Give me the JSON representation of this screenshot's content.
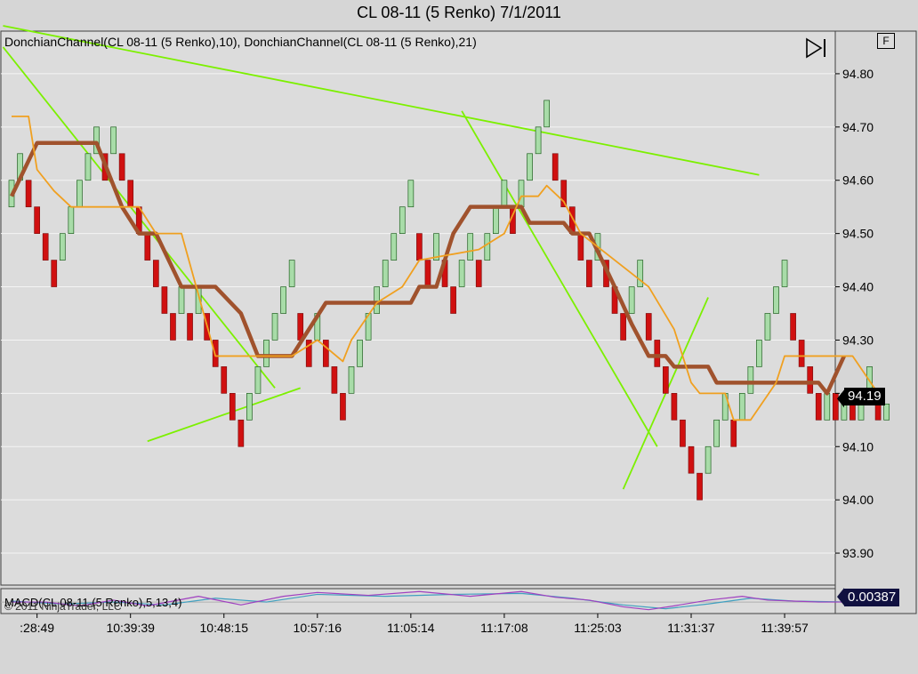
{
  "title": "CL 08-11 (5 Renko)  7/1/2011",
  "indicator_label": "DonchianChannel(CL 08-11 (5 Renko),10), DonchianChannel(CL 08-11 (5 Renko),21)",
  "macd_label": "MACD(CL 08-11 (5 Renko),5,13,4)",
  "copyright": "© 2011 NinjaTrader, LLC",
  "f_button": "F",
  "last_price": "94.19",
  "macd_value": "0.00387",
  "colors": {
    "background": "#dcdcdc",
    "up_brick": "#a8dca8",
    "down_brick": "#d01010",
    "donchian_10": "#f0a020",
    "donchian_21": "#a0522d",
    "trendline": "#7cf000",
    "macd_line": "#a040c0",
    "macd_signal": "#40a0c0"
  },
  "chart_data": {
    "type": "candlestick",
    "subtype": "renko",
    "brick_size": 0.05,
    "ylim": [
      93.84,
      94.88
    ],
    "yticks": [
      "94.80",
      "94.70",
      "94.60",
      "94.50",
      "94.40",
      "94.30",
      "94.00",
      "93.90"
    ],
    "ytick_values": [
      94.8,
      94.7,
      94.6,
      94.5,
      94.4,
      94.3,
      94.0,
      93.9
    ],
    "ytick_hidden_labels": [
      94.2,
      94.1
    ],
    "ytick_secondary": [
      {
        "value": 94.1,
        "label": "94.10"
      }
    ],
    "xticks": [
      ":28:49",
      "10:39:39",
      "10:48:15",
      "10:57:16",
      "11:05:14",
      "11:17:08",
      "11:25:03",
      "11:31:37",
      "11:39:57"
    ],
    "xtick_index": [
      3,
      14,
      25,
      36,
      47,
      58,
      69,
      80,
      91
    ],
    "bricks": [
      {
        "o": 94.55,
        "c": 94.6
      },
      {
        "o": 94.6,
        "c": 94.65
      },
      {
        "o": 94.6,
        "c": 94.55
      },
      {
        "o": 94.55,
        "c": 94.5
      },
      {
        "o": 94.5,
        "c": 94.45
      },
      {
        "o": 94.45,
        "c": 94.4
      },
      {
        "o": 94.45,
        "c": 94.5
      },
      {
        "o": 94.5,
        "c": 94.55
      },
      {
        "o": 94.55,
        "c": 94.6
      },
      {
        "o": 94.6,
        "c": 94.65
      },
      {
        "o": 94.65,
        "c": 94.7
      },
      {
        "o": 94.65,
        "c": 94.6
      },
      {
        "o": 94.65,
        "c": 94.7
      },
      {
        "o": 94.65,
        "c": 94.6
      },
      {
        "o": 94.6,
        "c": 94.55
      },
      {
        "o": 94.55,
        "c": 94.5
      },
      {
        "o": 94.5,
        "c": 94.45
      },
      {
        "o": 94.45,
        "c": 94.4
      },
      {
        "o": 94.4,
        "c": 94.35
      },
      {
        "o": 94.35,
        "c": 94.3
      },
      {
        "o": 94.35,
        "c": 94.4
      },
      {
        "o": 94.35,
        "c": 94.3
      },
      {
        "o": 94.35,
        "c": 94.4
      },
      {
        "o": 94.35,
        "c": 94.3
      },
      {
        "o": 94.3,
        "c": 94.25
      },
      {
        "o": 94.25,
        "c": 94.2
      },
      {
        "o": 94.2,
        "c": 94.15
      },
      {
        "o": 94.15,
        "c": 94.1
      },
      {
        "o": 94.15,
        "c": 94.2
      },
      {
        "o": 94.2,
        "c": 94.25
      },
      {
        "o": 94.25,
        "c": 94.3
      },
      {
        "o": 94.3,
        "c": 94.35
      },
      {
        "o": 94.35,
        "c": 94.4
      },
      {
        "o": 94.4,
        "c": 94.45
      },
      {
        "o": 94.35,
        "c": 94.3
      },
      {
        "o": 94.3,
        "c": 94.25
      },
      {
        "o": 94.3,
        "c": 94.35
      },
      {
        "o": 94.3,
        "c": 94.25
      },
      {
        "o": 94.25,
        "c": 94.2
      },
      {
        "o": 94.2,
        "c": 94.15
      },
      {
        "o": 94.2,
        "c": 94.25
      },
      {
        "o": 94.25,
        "c": 94.3
      },
      {
        "o": 94.3,
        "c": 94.35
      },
      {
        "o": 94.35,
        "c": 94.4
      },
      {
        "o": 94.4,
        "c": 94.45
      },
      {
        "o": 94.45,
        "c": 94.5
      },
      {
        "o": 94.5,
        "c": 94.55
      },
      {
        "o": 94.55,
        "c": 94.6
      },
      {
        "o": 94.5,
        "c": 94.45
      },
      {
        "o": 94.45,
        "c": 94.4
      },
      {
        "o": 94.45,
        "c": 94.5
      },
      {
        "o": 94.45,
        "c": 94.4
      },
      {
        "o": 94.4,
        "c": 94.35
      },
      {
        "o": 94.4,
        "c": 94.45
      },
      {
        "o": 94.45,
        "c": 94.5
      },
      {
        "o": 94.45,
        "c": 94.4
      },
      {
        "o": 94.45,
        "c": 94.5
      },
      {
        "o": 94.5,
        "c": 94.55
      },
      {
        "o": 94.55,
        "c": 94.6
      },
      {
        "o": 94.55,
        "c": 94.5
      },
      {
        "o": 94.55,
        "c": 94.6
      },
      {
        "o": 94.6,
        "c": 94.65
      },
      {
        "o": 94.65,
        "c": 94.7
      },
      {
        "o": 94.7,
        "c": 94.75
      },
      {
        "o": 94.65,
        "c": 94.6
      },
      {
        "o": 94.6,
        "c": 94.55
      },
      {
        "o": 94.55,
        "c": 94.5
      },
      {
        "o": 94.5,
        "c": 94.45
      },
      {
        "o": 94.45,
        "c": 94.4
      },
      {
        "o": 94.45,
        "c": 94.5
      },
      {
        "o": 94.45,
        "c": 94.4
      },
      {
        "o": 94.4,
        "c": 94.35
      },
      {
        "o": 94.35,
        "c": 94.3
      },
      {
        "o": 94.35,
        "c": 94.4
      },
      {
        "o": 94.4,
        "c": 94.45
      },
      {
        "o": 94.35,
        "c": 94.3
      },
      {
        "o": 94.3,
        "c": 94.25
      },
      {
        "o": 94.25,
        "c": 94.2
      },
      {
        "o": 94.2,
        "c": 94.15
      },
      {
        "o": 94.15,
        "c": 94.1
      },
      {
        "o": 94.1,
        "c": 94.05
      },
      {
        "o": 94.05,
        "c": 94.0
      },
      {
        "o": 94.05,
        "c": 94.1
      },
      {
        "o": 94.1,
        "c": 94.15
      },
      {
        "o": 94.15,
        "c": 94.2
      },
      {
        "o": 94.15,
        "c": 94.1
      },
      {
        "o": 94.15,
        "c": 94.2
      },
      {
        "o": 94.2,
        "c": 94.25
      },
      {
        "o": 94.25,
        "c": 94.3
      },
      {
        "o": 94.3,
        "c": 94.35
      },
      {
        "o": 94.35,
        "c": 94.4
      },
      {
        "o": 94.4,
        "c": 94.45
      },
      {
        "o": 94.35,
        "c": 94.3
      },
      {
        "o": 94.3,
        "c": 94.25
      },
      {
        "o": 94.25,
        "c": 94.2
      },
      {
        "o": 94.2,
        "c": 94.15
      },
      {
        "o": 94.15,
        "c": 94.2
      },
      {
        "o": 94.2,
        "c": 94.15
      },
      {
        "o": 94.15,
        "c": 94.2
      },
      {
        "o": 94.2,
        "c": 94.15
      },
      {
        "o": 94.15,
        "c": 94.2
      },
      {
        "o": 94.2,
        "c": 94.25
      },
      {
        "o": 94.2,
        "c": 94.15
      },
      {
        "o": 94.15,
        "c": 94.18
      }
    ],
    "donchian_10_mid": [
      [
        0,
        94.72
      ],
      [
        2,
        94.72
      ],
      [
        3,
        94.62
      ],
      [
        5,
        94.58
      ],
      [
        7,
        94.55
      ],
      [
        15,
        94.55
      ],
      [
        17,
        94.5
      ],
      [
        20,
        94.5
      ],
      [
        24,
        94.27
      ],
      [
        33,
        94.27
      ],
      [
        36,
        94.3
      ],
      [
        39,
        94.26
      ],
      [
        40,
        94.3
      ],
      [
        43,
        94.37
      ],
      [
        46,
        94.4
      ],
      [
        48,
        94.45
      ],
      [
        55,
        94.47
      ],
      [
        58,
        94.5
      ],
      [
        60,
        94.57
      ],
      [
        62,
        94.57
      ],
      [
        63,
        94.59
      ],
      [
        65,
        94.56
      ],
      [
        67,
        94.5
      ],
      [
        71,
        94.45
      ],
      [
        75,
        94.4
      ],
      [
        78,
        94.32
      ],
      [
        80,
        94.22
      ],
      [
        81,
        94.2
      ],
      [
        84,
        94.2
      ],
      [
        85,
        94.15
      ],
      [
        87,
        94.15
      ],
      [
        90,
        94.22
      ],
      [
        91,
        94.27
      ],
      [
        99,
        94.27
      ],
      [
        102,
        94.2
      ]
    ],
    "donchian_21_mid": [
      [
        0,
        94.57
      ],
      [
        3,
        94.67
      ],
      [
        10,
        94.67
      ],
      [
        11,
        94.63
      ],
      [
        13,
        94.55
      ],
      [
        15,
        94.5
      ],
      [
        17,
        94.5
      ],
      [
        20,
        94.4
      ],
      [
        24,
        94.4
      ],
      [
        27,
        94.35
      ],
      [
        29,
        94.27
      ],
      [
        33,
        94.27
      ],
      [
        37,
        94.37
      ],
      [
        47,
        94.37
      ],
      [
        48,
        94.4
      ],
      [
        50,
        94.4
      ],
      [
        52,
        94.5
      ],
      [
        54,
        94.55
      ],
      [
        60,
        94.55
      ],
      [
        61,
        94.52
      ],
      [
        65,
        94.52
      ],
      [
        66,
        94.5
      ],
      [
        68,
        94.5
      ],
      [
        71,
        94.4
      ],
      [
        73,
        94.33
      ],
      [
        75,
        94.27
      ],
      [
        77,
        94.27
      ],
      [
        78,
        94.25
      ],
      [
        82,
        94.25
      ],
      [
        83,
        94.22
      ],
      [
        90,
        94.22
      ],
      [
        91,
        94.22
      ],
      [
        95,
        94.22
      ],
      [
        96,
        94.2
      ],
      [
        98,
        94.27
      ]
    ],
    "trendlines": [
      {
        "from": [
          -1,
          94.89
        ],
        "to": [
          88,
          94.61
        ]
      },
      {
        "from": [
          -1,
          94.85
        ],
        "to": [
          31,
          94.21
        ]
      },
      {
        "from": [
          16,
          94.11
        ],
        "to": [
          34,
          94.21
        ]
      },
      {
        "from": [
          53,
          94.73
        ],
        "to": [
          76,
          94.1
        ]
      },
      {
        "from": [
          72,
          94.02
        ],
        "to": [
          82,
          94.38
        ]
      }
    ],
    "macd": {
      "macd": [
        [
          0,
          0.0
        ],
        [
          4,
          0.0
        ],
        [
          8,
          -0.004
        ],
        [
          12,
          0.002
        ],
        [
          16,
          -0.004
        ],
        [
          22,
          0.006
        ],
        [
          27,
          -0.003
        ],
        [
          32,
          0.006
        ],
        [
          36,
          0.01
        ],
        [
          42,
          0.007
        ],
        [
          48,
          0.011
        ],
        [
          54,
          0.006
        ],
        [
          60,
          0.011
        ],
        [
          64,
          0.005
        ],
        [
          68,
          0.002
        ],
        [
          72,
          -0.005
        ],
        [
          75,
          -0.008
        ],
        [
          78,
          -0.004
        ],
        [
          82,
          0.002
        ],
        [
          86,
          0.006
        ],
        [
          89,
          0.002
        ],
        [
          95,
          0.0
        ],
        [
          99,
          0.0
        ]
      ],
      "signal": [
        [
          0,
          0.001
        ],
        [
          6,
          -0.002
        ],
        [
          12,
          0.0
        ],
        [
          18,
          -0.003
        ],
        [
          24,
          0.004
        ],
        [
          30,
          0.0
        ],
        [
          36,
          0.008
        ],
        [
          44,
          0.006
        ],
        [
          52,
          0.008
        ],
        [
          60,
          0.009
        ],
        [
          66,
          0.004
        ],
        [
          72,
          -0.003
        ],
        [
          77,
          -0.007
        ],
        [
          82,
          -0.002
        ],
        [
          87,
          0.004
        ],
        [
          92,
          0.001
        ],
        [
          99,
          0.0
        ]
      ],
      "ylim": [
        -0.012,
        0.014
      ]
    }
  }
}
